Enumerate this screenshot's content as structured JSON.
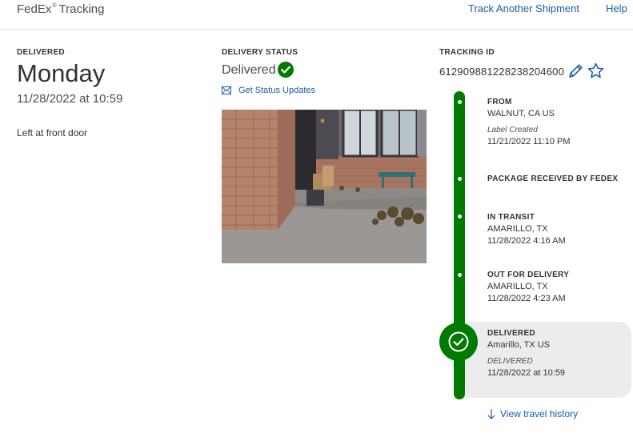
{
  "header": {
    "brand": "FedEx",
    "brand_mark": "®",
    "brand_suffix": "Tracking",
    "track_link": "Track Another Shipment",
    "help_link": "Help"
  },
  "summary": {
    "label": "DELIVERED",
    "day": "Monday",
    "datetime": "11/28/2022 at 10:59",
    "note": "Left at front door"
  },
  "status": {
    "label": "DELIVERY STATUS",
    "value": "Delivered",
    "updates_link": "Get Status Updates",
    "photo_icon": "proof-of-delivery-photo"
  },
  "tracking": {
    "label": "TRACKING ID",
    "id": "612909881228238204600",
    "edit_icon": "pencil-icon",
    "favorite_icon": "star-icon"
  },
  "timeline": {
    "events": [
      {
        "title": "FROM",
        "location": "WALNUT, CA US",
        "note": "Label Created",
        "time": "11/21/2022 11:10 PM"
      },
      {
        "title": "PACKAGE RECEIVED BY FEDEX"
      },
      {
        "title": "IN TRANSIT",
        "location": "AMARILLO, TX",
        "time": "11/28/2022 4:16 AM"
      },
      {
        "title": "OUT FOR DELIVERY",
        "location": "AMARILLO, TX",
        "time": "11/28/2022 4:23 AM"
      },
      {
        "title": "DELIVERED",
        "location": "Amarillo, TX US",
        "note": "DELIVERED",
        "time": "11/28/2022 at 10:59"
      }
    ],
    "history_link": "View travel history"
  },
  "colors": {
    "accent_green": "#007a00",
    "link_blue": "#1a5ca8"
  }
}
